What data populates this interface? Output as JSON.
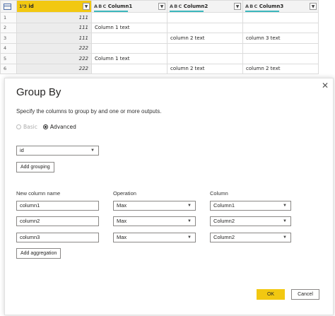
{
  "grid": {
    "columns": [
      {
        "type": "1²3",
        "name": "id"
      },
      {
        "type": "A B C",
        "name": "Column1"
      },
      {
        "type": "A B C",
        "name": "Column2"
      },
      {
        "type": "A B C",
        "name": "Column3"
      }
    ],
    "rows": [
      {
        "num": "1",
        "id": "111",
        "c1": "",
        "c2": "",
        "c3": ""
      },
      {
        "num": "2",
        "id": "111",
        "c1": "Column 1 text",
        "c2": "",
        "c3": ""
      },
      {
        "num": "3",
        "id": "111",
        "c1": "",
        "c2": "column 2 text",
        "c3": "column 3 text"
      },
      {
        "num": "4",
        "id": "222",
        "c1": "",
        "c2": "",
        "c3": ""
      },
      {
        "num": "5",
        "id": "222",
        "c1": "Column 1 text",
        "c2": "",
        "c3": ""
      },
      {
        "num": "6",
        "id": "222",
        "c1": "",
        "c2": "column 2 text",
        "c3": "column 2 text"
      }
    ]
  },
  "dialog": {
    "title": "Group By",
    "subtitle": "Specify the columns to group by and one or more outputs.",
    "radio_basic": "Basic",
    "radio_advanced": "Advanced",
    "group_by_value": "id",
    "add_grouping": "Add grouping",
    "labels": {
      "new_column_name": "New column name",
      "operation": "Operation",
      "column": "Column"
    },
    "aggregations": [
      {
        "name": "column1",
        "operation": "Max",
        "column": "Column1"
      },
      {
        "name": "column2",
        "operation": "Max",
        "column": "Column2"
      },
      {
        "name": "column3",
        "operation": "Max",
        "column": "Column2"
      }
    ],
    "add_aggregation": "Add aggregation",
    "ok": "OK",
    "cancel": "Cancel",
    "close": "✕"
  },
  "colors": {
    "accent": "#f2c811",
    "quality_bar": "#3cb7bd"
  }
}
